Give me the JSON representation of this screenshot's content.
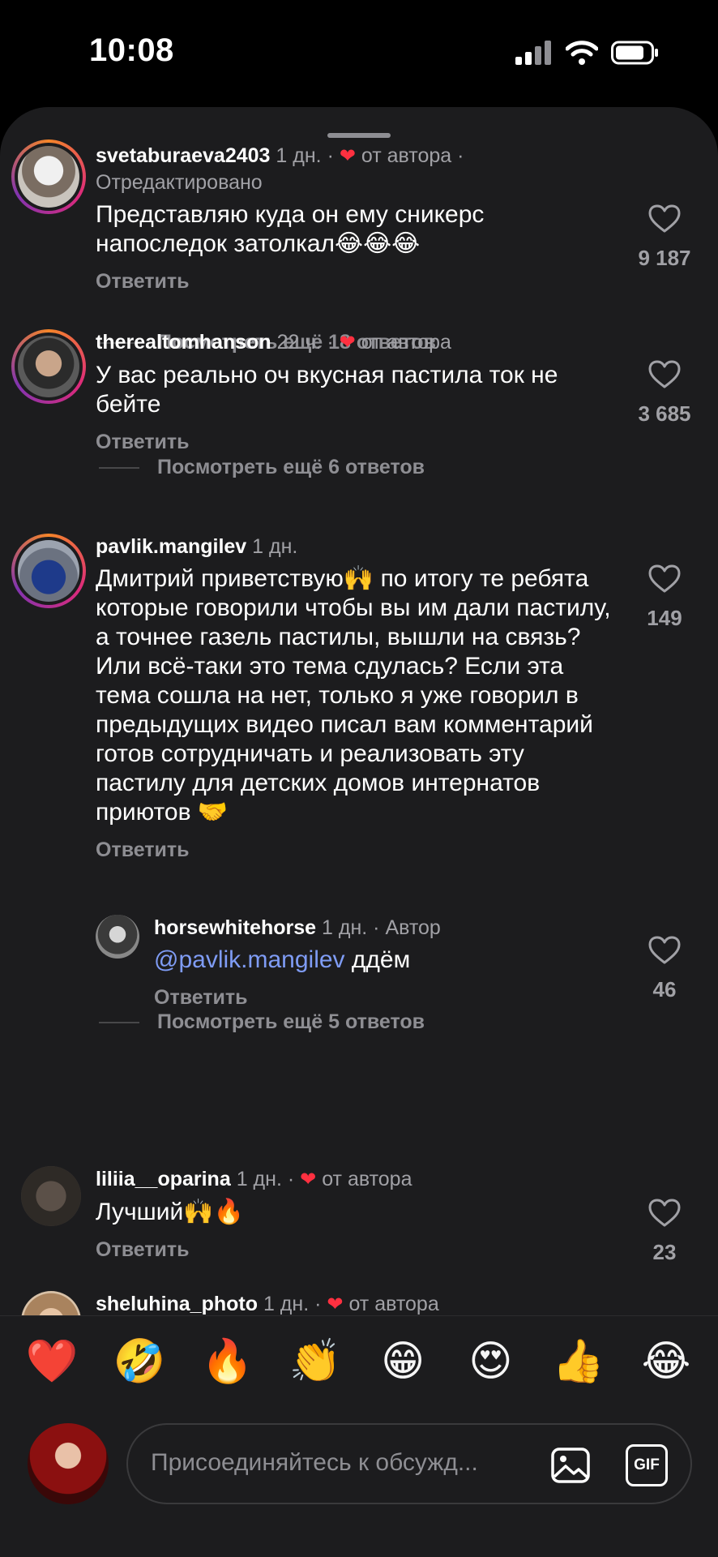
{
  "status": {
    "time": "10:08"
  },
  "comments": [
    {
      "username": "svetaburaeva2403",
      "age": "1 дн.",
      "author_liked": true,
      "author_like_text": "от автора",
      "edited": "Отредактировано",
      "text": "Представляю куда он ему сникерс напоследок затолкал😂😂😂",
      "reply_label": "Ответить",
      "likes": "9 187",
      "more_replies": "Посмотреть ещё 18 ответов"
    },
    {
      "username": "therealtomhanson",
      "age": "22 ч.",
      "author_liked": true,
      "author_like_text": "от автора",
      "text": "У вас реально оч вкусная пастила ток не бейте",
      "reply_label": "Ответить",
      "likes": "3 685",
      "more_replies": "Посмотреть ещё 6 ответов"
    },
    {
      "username": "pavlik.mangilev",
      "age": "1 дн.",
      "text": "Дмитрий приветствую🙌 по итогу те ребята которые говорили чтобы вы им дали пастилу, а точнее газель пастилы, вышли на связь? Или всё-таки это тема сдулась? Если эта тема сошла на нет, только я уже говорил в предыдущих видео писал вам комментарий готов сотрудничать и реализовать эту пастилу для детских домов интернатов приютов 🤝",
      "reply_label": "Ответить",
      "likes": "149",
      "reply": {
        "username": "horsewhitehorse",
        "age": "1 дн.",
        "badge": "Автор",
        "mention": "@pavlik.mangilev",
        "text": "ддём",
        "reply_label": "Ответить",
        "likes": "46"
      },
      "more_replies": "Посмотреть ещё 5 ответов"
    },
    {
      "username": "liliia__oparina",
      "age": "1 дн.",
      "author_liked": true,
      "author_like_text": "от автора",
      "text": "Лучший🙌🔥",
      "reply_label": "Ответить",
      "likes": "23"
    },
    {
      "username": "sheluhina_photo",
      "age": "1 дн.",
      "author_liked": true,
      "author_like_text": "от автора"
    }
  ],
  "emoji_bar": [
    "❤️",
    "🤣",
    "🔥",
    "👏",
    "😁",
    "😍",
    "👍",
    "😂"
  ],
  "composer": {
    "placeholder": "Присоединяйтесь к обсужд...",
    "gif_label": "GIF"
  },
  "icons": {
    "like": "heart-outline-icon",
    "author_like": "red-heart-icon",
    "image": "image-icon",
    "gif": "gif-icon"
  },
  "colors": {
    "background": "#1c1c1e",
    "author_heart": "#ff3040",
    "mention": "#7f9cf5"
  }
}
